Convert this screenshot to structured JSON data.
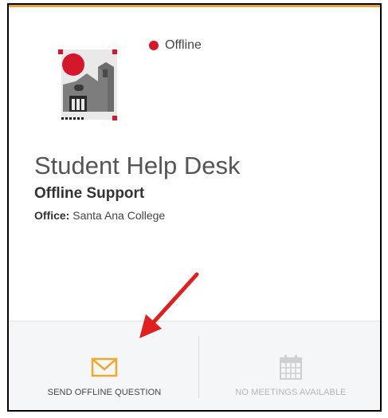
{
  "status": {
    "label": "Offline",
    "color": "#d4172a"
  },
  "title": "Student Help Desk",
  "subtitle": "Offline Support",
  "office": {
    "label": "Office:",
    "value": "Santa Ana College"
  },
  "actions": {
    "send_question": {
      "label": "SEND OFFLINE QUESTION",
      "icon": "envelope-icon",
      "color": "#f0a830"
    },
    "meetings": {
      "label": "NO MEETINGS AVAILABLE",
      "icon": "calendar-icon",
      "color": "#cfcfcf"
    }
  },
  "annotation": {
    "icon": "red-arrow-icon",
    "color": "#e02020"
  },
  "logo": {
    "icon": "college-building-logo",
    "accent_color": "#d4172a"
  }
}
